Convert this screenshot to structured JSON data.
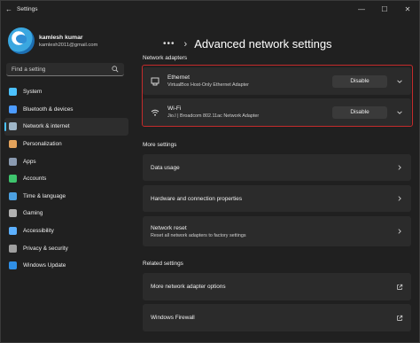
{
  "window": {
    "title": "Settings",
    "back_glyph": "←",
    "controls": {
      "minimize": "—",
      "maximize": "☐",
      "close": "✕"
    }
  },
  "profile": {
    "name": "kamlesh kumar",
    "email": "kamlesh2011@gmail.com"
  },
  "search": {
    "placeholder": "Find a setting"
  },
  "sidebar": {
    "items": [
      {
        "label": "System",
        "icon": "system-icon",
        "color": "#4cc2ff",
        "active": false
      },
      {
        "label": "Bluetooth & devices",
        "icon": "bluetooth-icon",
        "color": "#4c9bff",
        "active": false
      },
      {
        "label": "Network & internet",
        "icon": "network-icon",
        "color": "#9fb6c8",
        "active": true
      },
      {
        "label": "Personalization",
        "icon": "personalization-icon",
        "color": "#e3a35c",
        "active": false
      },
      {
        "label": "Apps",
        "icon": "apps-icon",
        "color": "#8a9ab0",
        "active": false
      },
      {
        "label": "Accounts",
        "icon": "accounts-icon",
        "color": "#3ec46d",
        "active": false
      },
      {
        "label": "Time & language",
        "icon": "time-language-icon",
        "color": "#4ca0e0",
        "active": false
      },
      {
        "label": "Gaming",
        "icon": "gaming-icon",
        "color": "#b0b0b0",
        "active": false
      },
      {
        "label": "Accessibility",
        "icon": "accessibility-icon",
        "color": "#5cb0ff",
        "active": false
      },
      {
        "label": "Privacy & security",
        "icon": "shield-icon",
        "color": "#a0a0a0",
        "active": false
      },
      {
        "label": "Windows Update",
        "icon": "windows-update-icon",
        "color": "#2f8fe6",
        "active": false
      }
    ]
  },
  "breadcrumb": {
    "overflow": "•••",
    "separator": "›",
    "title": "Advanced network settings"
  },
  "network_adapters": {
    "label": "Network adapters",
    "items": [
      {
        "name": "Ethernet",
        "description": "VirtualBox Host-Only Ethernet Adapter",
        "icon": "ethernet-icon",
        "button": "Disable"
      },
      {
        "name": "Wi-Fi",
        "description": "Jio.l | Broadcom 802.11ac Network Adapter",
        "icon": "wifi-icon",
        "button": "Disable"
      }
    ]
  },
  "more_settings": {
    "label": "More settings",
    "items": [
      {
        "title": "Data usage"
      },
      {
        "title": "Hardware and connection properties"
      },
      {
        "title": "Network reset",
        "description": "Reset all network adapters to factory settings"
      }
    ]
  },
  "related_settings": {
    "label": "Related settings",
    "items": [
      {
        "title": "More network adapter options",
        "icon": "external-link-icon"
      },
      {
        "title": "Windows Firewall",
        "icon": "external-link-icon"
      }
    ]
  },
  "colors": {
    "accent": "#4cc2ff",
    "highlight": "#c42b2b",
    "card": "#2b2b2b",
    "background": "#202020"
  }
}
